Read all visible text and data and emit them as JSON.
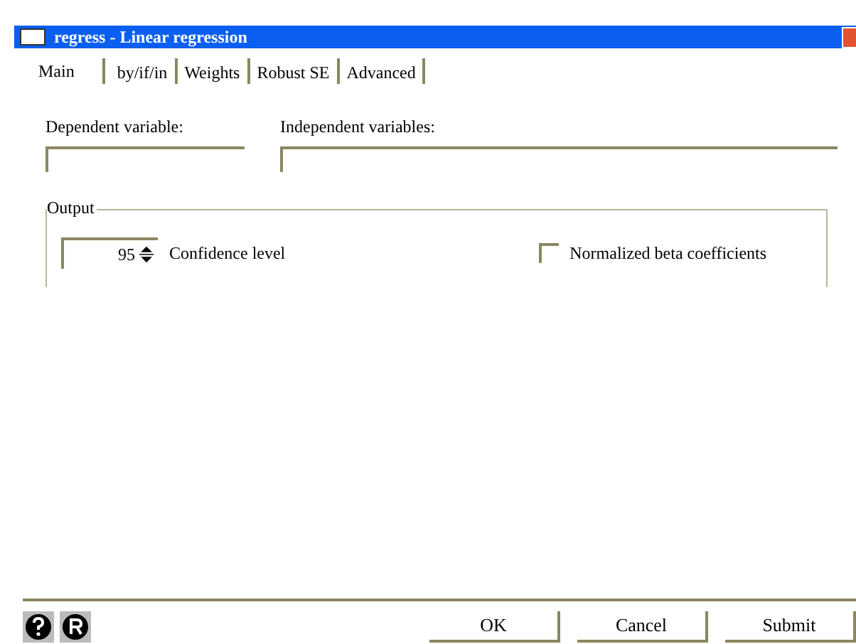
{
  "window": {
    "title": "regress - Linear regression"
  },
  "tabs": [
    {
      "label": "Main",
      "selected": true
    },
    {
      "label": "by/if/in",
      "selected": false
    },
    {
      "label": "Weights",
      "selected": false
    },
    {
      "label": "Robust SE",
      "selected": false
    },
    {
      "label": "Advanced",
      "selected": false
    }
  ],
  "fields": [
    {
      "label": "Dependent variable:"
    },
    {
      "label": "Independent variables:"
    }
  ],
  "output": {
    "title": "Output",
    "confidence": {
      "value": "95",
      "label": "Confidence level"
    },
    "normalized": {
      "label": "Normalized beta coefficients",
      "checked": false
    }
  },
  "buttons": [
    "OK",
    "Cancel",
    "Submit"
  ]
}
